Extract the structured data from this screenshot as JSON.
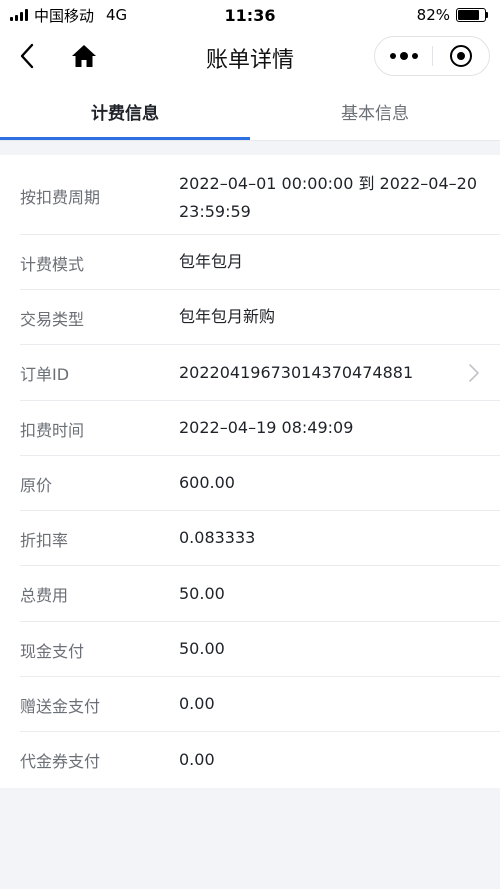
{
  "status_bar": {
    "carrier": "中国移动",
    "network": "4G",
    "time": "11:36",
    "battery": "82%",
    "battery_level": 0.82
  },
  "nav": {
    "title": "账单详情",
    "back_icon": "chevron-left-icon",
    "home_icon": "home-icon",
    "more_icon": "more-dots-icon",
    "close_icon": "target-ring-icon"
  },
  "tabs": [
    {
      "label": "计费信息",
      "active": true
    },
    {
      "label": "基本信息",
      "active": false
    }
  ],
  "details": [
    {
      "label": "按扣费周期",
      "value": "2022–04–01 00:00:00 到 2022–04–20 23:59:59"
    },
    {
      "label": "计费模式",
      "value": "包年包月"
    },
    {
      "label": "交易类型",
      "value": "包年包月新购"
    },
    {
      "label": "订单ID",
      "value": "20220419673014370474881",
      "has_link": true
    },
    {
      "label": "扣费时间",
      "value": "2022–04–19 08:49:09"
    },
    {
      "label": "原价",
      "value": "600.00"
    },
    {
      "label": "折扣率",
      "value": "0.083333"
    },
    {
      "label": "总费用",
      "value": "50.00"
    },
    {
      "label": "现金支付",
      "value": "50.00"
    },
    {
      "label": "赠送金支付",
      "value": "0.00"
    },
    {
      "label": "代金券支付",
      "value": "0.00"
    }
  ],
  "colors": {
    "accent": "#2f6fe4",
    "label": "#6b6f76",
    "value": "#1f2329",
    "background": "#f3f4f7"
  }
}
